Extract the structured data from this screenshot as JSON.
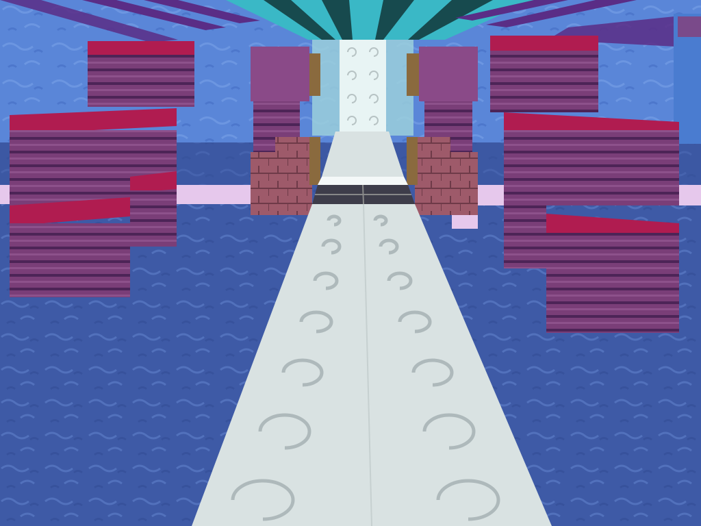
{
  "game": {
    "view": "first-person",
    "hud_visible": false,
    "colors": {
      "sky": "#5a86d8",
      "sky_dark": "#3f67bf",
      "water": "#3e5aa6",
      "water_light": "#5a7ccc",
      "path": "#d9e2e2",
      "path_swirl": "#aeb9bb",
      "pillar_side": "#7a3e78",
      "pillar_stripe": "#4d2457",
      "pillar_top": "#b01c50",
      "brick": "#9e5a6a",
      "ceiling_teal": "#3ab8c6",
      "ceiling_dark": "#174a4e",
      "ceiling_purple": "#5a2d86",
      "pink_strip": "#e6c8ec",
      "glass": "#e8f4f4",
      "door_frame": "#8a6a3e",
      "tile_dark": "#3e3d4a"
    },
    "blocks": [
      "swirl-quartz-path",
      "striped-purpur-pillars",
      "crimson-block-caps",
      "pink-bricks",
      "water-surface",
      "teal-ceiling-beams"
    ]
  }
}
